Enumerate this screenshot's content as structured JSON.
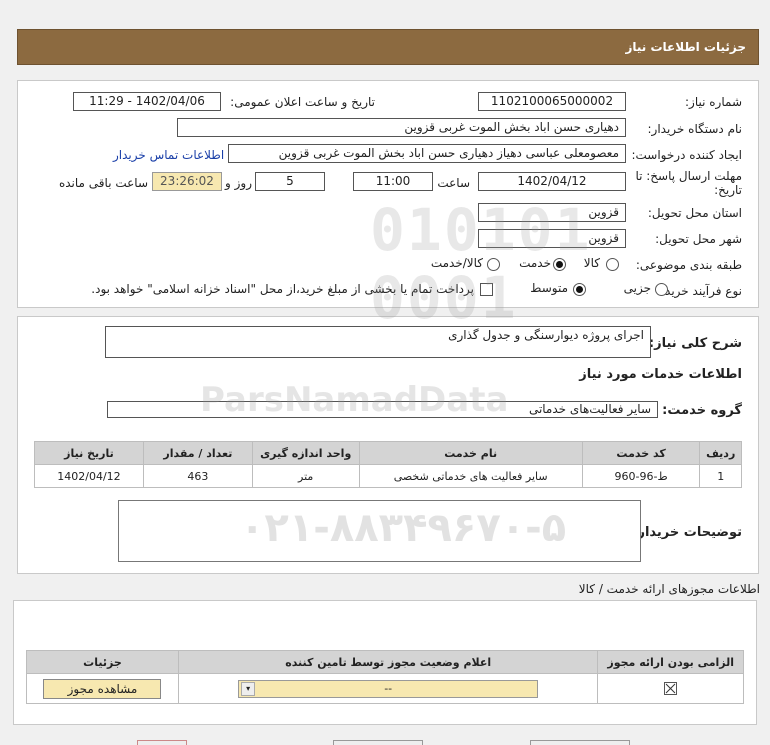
{
  "header": {
    "title": "جزئیات اطلاعات نیاز"
  },
  "form": {
    "need_number_label": "شماره نیاز:",
    "need_number": "1102100065000002",
    "announce_label": "تاریخ و ساعت اعلان عمومی:",
    "announce_value": "1402/04/06 - 11:29",
    "buyer_label": "نام دستگاه خریدار:",
    "buyer_value": "دهیاری حسن اباد بخش الموت غربی قزوین",
    "requester_label": "ایجاد کننده درخواست:",
    "requester_value": "معصومعلی عباسی دهیاز دهیاری حسن اباد بخش الموت غربی قزوین",
    "contact_link": "اطلاعات تماس خریدار",
    "deadline_label_1": "مهلت ارسال پاسخ: تا",
    "deadline_label_2": "تاریخ:",
    "deadline_date": "1402/04/12",
    "time_label": "ساعت",
    "deadline_time": "11:00",
    "days_value": "5",
    "days_label": "روز و",
    "remaining_value": "23:26:02",
    "remaining_label": "ساعت باقی مانده",
    "province_label": "استان محل تحویل:",
    "province_value": "قزوین",
    "city_label": "شهر محل تحویل:",
    "city_value": "قزوین",
    "category_label": "طبقه بندی موضوعی:",
    "category_options": [
      "کالا",
      "خدمت",
      "کالا/خدمت"
    ],
    "category_selected": "خدمت",
    "process_label": "نوع فرآیند خرید :",
    "process_options": [
      "جزیی",
      "متوسط"
    ],
    "process_selected": "متوسط",
    "payment_note": "پرداخت تمام یا بخشی از مبلغ خرید،از محل \"اسناد خزانه اسلامی\" خواهد بود."
  },
  "summary": {
    "label": "شرح کلی نیاز:",
    "value": "اجرای پروژه دیوارسنگی و جدول گذاری",
    "services_title": "اطلاعات خدمات مورد نیاز",
    "group_label": "گروه خدمت:",
    "group_value": "سایر فعالیت‌های خدماتی"
  },
  "services_table": {
    "headers": [
      "ردیف",
      "کد خدمت",
      "نام خدمت",
      "واحد اندازه گیری",
      "تعداد / مقدار",
      "تاریخ نیاز"
    ],
    "rows": [
      [
        "1",
        "ط-96-960",
        "سایر فعالیت های خدماتی شخصی",
        "متر",
        "463",
        "1402/04/12"
      ]
    ]
  },
  "buyer_notes": {
    "label": "توضیحات خریدار:",
    "value": ""
  },
  "permits": {
    "title": "اطلاعات مجوزهای ارائه خدمت / کالا",
    "headers": [
      "الزامی بودن ارائه مجوز",
      "اعلام وضعیت مجوز توسط تامین کننده",
      "جزئیات"
    ],
    "select_value": "--",
    "view_button": "مشاهده مجوز"
  },
  "watermark": {
    "line1": "ParsNamadData",
    "line2": "۰۲۱-۸۸۳۴۹۶۷۰-۵"
  }
}
